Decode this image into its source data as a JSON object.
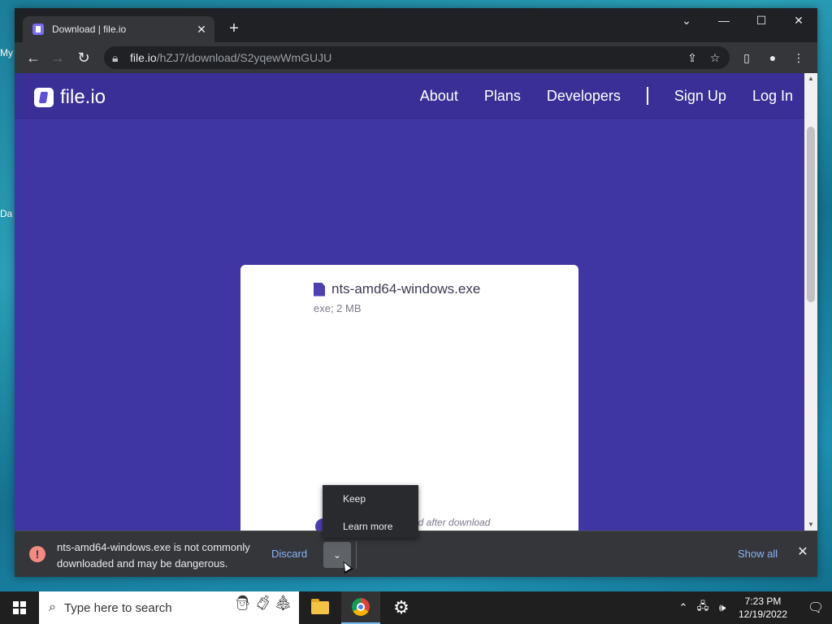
{
  "desktop": {
    "icon1_label": "My",
    "icon2_label": "Da"
  },
  "browser": {
    "tab_title": "Download | file.io",
    "new_tab": "+",
    "url_host": "file.io",
    "url_path": "/hZJ7/download/S2yqewWmGUJU"
  },
  "site": {
    "logo_text": "file.io",
    "nav": [
      "About",
      "Plans",
      "Developers",
      "Sign Up",
      "Log In"
    ],
    "file_name": "nts-amd64-windows.exe",
    "file_meta": "exe; 2 MB",
    "deleted_note": "ed after download"
  },
  "context_menu": {
    "items": [
      "Keep",
      "Learn more"
    ]
  },
  "download_shelf": {
    "warning_text": "nts-amd64-windows.exe is not commonly downloaded and may be dangerous.",
    "discard": "Discard",
    "show_all": "Show all"
  },
  "taskbar": {
    "search_placeholder": "Type here to search",
    "time": "7:23 PM",
    "date": "12/19/2022"
  }
}
